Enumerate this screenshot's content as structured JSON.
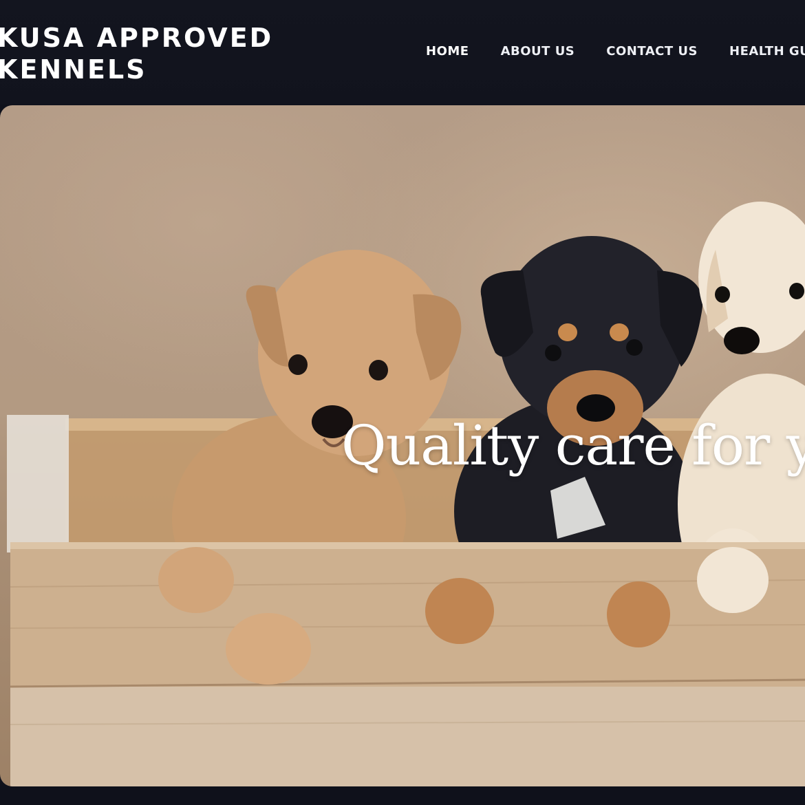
{
  "brand": {
    "line1": "KUSA APPROVED",
    "line2": "KENNELS"
  },
  "nav": {
    "items": [
      {
        "label": "HOME",
        "active": true
      },
      {
        "label": "ABOUT US",
        "active": false
      },
      {
        "label": "CONTACT US",
        "active": false
      },
      {
        "label": "HEALTH GUARA",
        "active": false
      }
    ]
  },
  "hero": {
    "headline": "Quality care for yo"
  },
  "colors": {
    "header_bg": "#13151f",
    "text": "#ffffff",
    "wood": "#c9ad8f",
    "puppy_tan": "#c9976a",
    "puppy_black": "#1d1d24",
    "puppy_cream": "#efe2cf"
  }
}
